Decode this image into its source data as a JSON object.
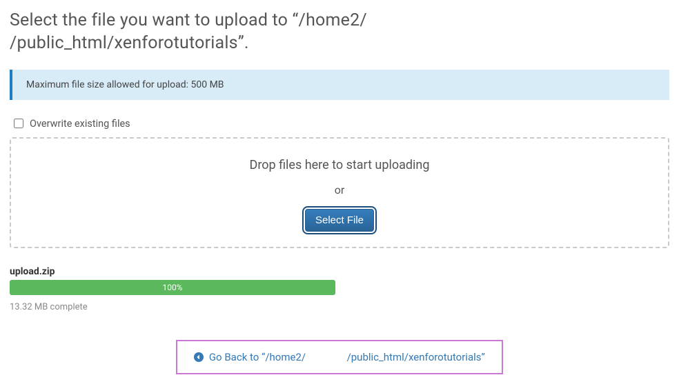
{
  "header": {
    "title_prefix": "Select the file you want to upload to “/home2/",
    "title_suffix": "/public_html/xenforotutorials”."
  },
  "info_box": {
    "text": "Maximum file size allowed for upload: 500 MB"
  },
  "overwrite": {
    "label": "Overwrite existing files",
    "checked": false
  },
  "drop_zone": {
    "line1": "Drop files here to start uploading",
    "line2": "or",
    "button_label": "Select File"
  },
  "upload": {
    "file_name": "upload.zip",
    "progress_percent": 100,
    "progress_label": "100%",
    "status_text": "13.32 MB complete"
  },
  "footer": {
    "back_prefix": "Go Back to “/home2/",
    "back_suffix": "/public_html/xenforotutorials”"
  }
}
